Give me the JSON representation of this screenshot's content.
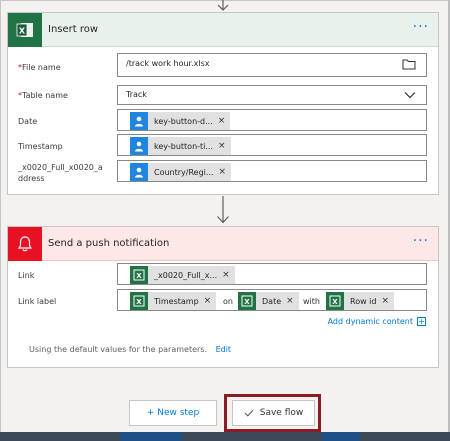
{
  "excel_card": {
    "title": "Insert row",
    "more": "···",
    "fields": {
      "file_name": {
        "label": "File name",
        "value": "/track work hour.xlsx"
      },
      "table_name": {
        "label": "Table name",
        "value": "Track"
      },
      "date": {
        "label": "Date",
        "token": "key-button-d..."
      },
      "timestamp": {
        "label": "Timestamp",
        "token": "key-button-ti..."
      },
      "address": {
        "label": "_x0020_Full_x0020_a\nddress",
        "token": "Country/Regi..."
      }
    },
    "required_mark": "*"
  },
  "notif_card": {
    "title": "Send a push notification",
    "more": "···",
    "link": {
      "label": "Link",
      "token": "_x0020_Full_x..."
    },
    "link_label": {
      "label": "Link label",
      "tokens": [
        "Timestamp",
        "Date",
        "Row id"
      ],
      "words": [
        "on",
        "with"
      ]
    },
    "add_dynamic": "Add dynamic content",
    "defaults_text": "Using the default values for the parameters.",
    "edit_label": "Edit"
  },
  "buttons": {
    "new_step": "+ New step",
    "save_flow": "Save flow"
  },
  "icons": {
    "excel": "excel-icon",
    "bell": "bell-icon",
    "folder": "folder-icon",
    "chevron": "chevron-down-icon",
    "person": "person-icon",
    "arrow": "arrow-down-icon",
    "check": "check-icon"
  },
  "colors": {
    "excel_green": "#217346",
    "notif_red": "#e81123",
    "accent_blue": "#0078d4",
    "token_blue": "#1f85de",
    "highlight": "#8b1c24"
  }
}
